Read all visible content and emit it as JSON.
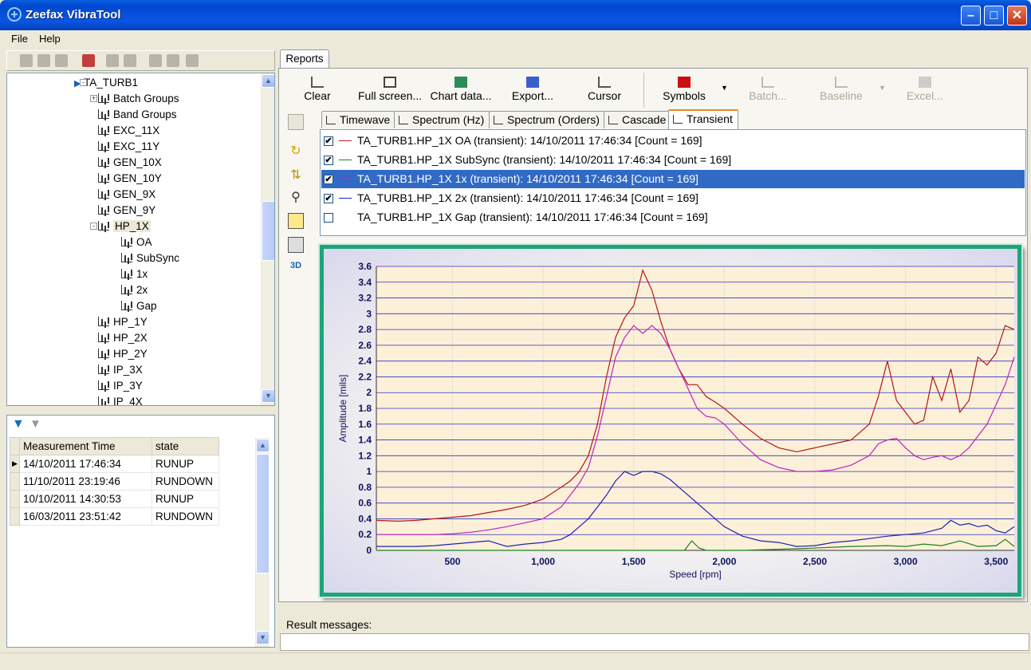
{
  "window": {
    "title": "Zeefax VibraTool"
  },
  "menu": {
    "file": "File",
    "help": "Help"
  },
  "tree": {
    "root": "TA_TURB1",
    "items": [
      "Batch Groups",
      "Band Groups",
      "EXC_11X",
      "EXC_11Y",
      "GEN_10X",
      "GEN_10Y",
      "GEN_9X",
      "GEN_9Y",
      "HP_1X",
      "OA",
      "SubSync",
      "1x",
      "2x",
      "Gap",
      "HP_1Y",
      "HP_2X",
      "HP_2Y",
      "IP_3X",
      "IP_3Y",
      "IP_4X"
    ]
  },
  "measurements": {
    "headers": [
      "Measurement Time",
      "state"
    ],
    "rows": [
      [
        "14/10/2011 17:46:34",
        "RUNUP"
      ],
      [
        "11/10/2011 23:19:46",
        "RUNDOWN"
      ],
      [
        "10/10/2011 14:30:53",
        "RUNUP"
      ],
      [
        "16/03/2011 23:51:42",
        "RUNDOWN"
      ]
    ]
  },
  "reports": {
    "tab": "Reports"
  },
  "toolbar": {
    "clear": "Clear",
    "fullscreen": "Full screen...",
    "chartdata": "Chart data...",
    "export": "Export...",
    "cursor": "Cursor",
    "symbols": "Symbols",
    "batch": "Batch...",
    "baseline": "Baseline",
    "excel": "Excel..."
  },
  "vtools": {
    "three_d": "3D"
  },
  "tabs": [
    "Timewave",
    "Spectrum (Hz)",
    "Spectrum (Orders)",
    "Cascade",
    "Transient"
  ],
  "series": [
    {
      "checked": true,
      "color": "#c02020",
      "text": "TA_TURB1.HP_1X OA (transient): 14/10/2011 17:46:34 [Count = 169]"
    },
    {
      "checked": true,
      "color": "#208020",
      "text": "TA_TURB1.HP_1X SubSync (transient): 14/10/2011 17:46:34 [Count = 169]"
    },
    {
      "checked": true,
      "color": "#d020d0",
      "text": "TA_TURB1.HP_1X 1x (transient): 14/10/2011 17:46:34 [Count = 169]"
    },
    {
      "checked": true,
      "color": "#2020c0",
      "text": "TA_TURB1.HP_1X 2x (transient): 14/10/2011 17:46:34 [Count = 169]"
    },
    {
      "checked": false,
      "color": "",
      "text": "TA_TURB1.HP_1X Gap (transient): 14/10/2011 17:46:34 [Count = 169]"
    }
  ],
  "result": {
    "label": "Result messages:"
  },
  "chart_data": {
    "type": "line",
    "xlabel": "Speed [rpm]",
    "ylabel": "Amplitude [mils]",
    "xlim": [
      80,
      3600
    ],
    "ylim": [
      0,
      3.6
    ],
    "xticks": [
      500,
      1000,
      1500,
      2000,
      2500,
      3000,
      3500
    ],
    "xticklabels": [
      "500",
      "1,000",
      "1,500",
      "2,000",
      "2,500",
      "3,000",
      "3,500"
    ],
    "yticks": [
      0,
      0.2,
      0.4,
      0.6,
      0.8,
      1,
      1.2,
      1.4,
      1.6,
      1.8,
      2,
      2.2,
      2.4,
      2.6,
      2.8,
      3,
      3.2,
      3.4,
      3.6
    ],
    "grid": true,
    "series": [
      {
        "color": "#b01818",
        "x": [
          80,
          200,
          300,
          400,
          500,
          600,
          700,
          800,
          900,
          1000,
          1100,
          1150,
          1200,
          1250,
          1300,
          1350,
          1400,
          1450,
          1500,
          1550,
          1600,
          1650,
          1700,
          1750,
          1800,
          1850,
          1900,
          1950,
          2000,
          2100,
          2200,
          2300,
          2400,
          2500,
          2600,
          2700,
          2800,
          2850,
          2900,
          2950,
          3000,
          3050,
          3100,
          3150,
          3200,
          3250,
          3300,
          3350,
          3400,
          3450,
          3500,
          3550,
          3600
        ],
        "y": [
          0.38,
          0.37,
          0.38,
          0.4,
          0.42,
          0.44,
          0.48,
          0.52,
          0.57,
          0.65,
          0.8,
          0.88,
          1.0,
          1.2,
          1.6,
          2.2,
          2.7,
          2.95,
          3.1,
          3.55,
          3.3,
          2.9,
          2.55,
          2.3,
          2.1,
          2.1,
          1.95,
          1.88,
          1.8,
          1.6,
          1.42,
          1.3,
          1.25,
          1.3,
          1.35,
          1.4,
          1.6,
          1.95,
          2.4,
          1.9,
          1.75,
          1.6,
          1.65,
          2.2,
          1.9,
          2.3,
          1.75,
          1.9,
          2.45,
          2.35,
          2.5,
          2.85,
          2.8
        ]
      },
      {
        "color": "#c020c0",
        "x": [
          80,
          200,
          300,
          400,
          500,
          600,
          700,
          800,
          900,
          1000,
          1100,
          1150,
          1200,
          1250,
          1300,
          1350,
          1400,
          1450,
          1500,
          1550,
          1600,
          1650,
          1700,
          1750,
          1800,
          1850,
          1900,
          1950,
          2000,
          2100,
          2200,
          2300,
          2400,
          2500,
          2600,
          2700,
          2800,
          2850,
          2900,
          2950,
          3000,
          3050,
          3100,
          3150,
          3200,
          3250,
          3300,
          3350,
          3400,
          3450,
          3500,
          3550,
          3600
        ],
        "y": [
          0.2,
          0.2,
          0.2,
          0.2,
          0.21,
          0.23,
          0.26,
          0.3,
          0.35,
          0.4,
          0.55,
          0.7,
          0.85,
          1.05,
          1.45,
          1.95,
          2.45,
          2.7,
          2.85,
          2.75,
          2.85,
          2.75,
          2.55,
          2.3,
          2.05,
          1.8,
          1.7,
          1.68,
          1.6,
          1.35,
          1.15,
          1.05,
          1.0,
          1.0,
          1.02,
          1.08,
          1.2,
          1.35,
          1.4,
          1.42,
          1.3,
          1.2,
          1.15,
          1.18,
          1.2,
          1.15,
          1.2,
          1.3,
          1.45,
          1.6,
          1.85,
          2.1,
          2.45
        ]
      },
      {
        "color": "#2020b0",
        "x": [
          80,
          200,
          300,
          400,
          500,
          600,
          700,
          800,
          900,
          1000,
          1100,
          1150,
          1200,
          1250,
          1300,
          1350,
          1400,
          1450,
          1500,
          1550,
          1600,
          1650,
          1700,
          1750,
          1800,
          1850,
          1900,
          1950,
          2000,
          2100,
          2200,
          2300,
          2400,
          2500,
          2600,
          2700,
          2800,
          2900,
          3000,
          3100,
          3200,
          3250,
          3300,
          3350,
          3400,
          3450,
          3500,
          3550,
          3600
        ],
        "y": [
          0.05,
          0.05,
          0.05,
          0.06,
          0.08,
          0.1,
          0.12,
          0.05,
          0.08,
          0.1,
          0.14,
          0.2,
          0.3,
          0.4,
          0.55,
          0.7,
          0.88,
          1.0,
          0.95,
          1.0,
          1.0,
          0.97,
          0.9,
          0.8,
          0.7,
          0.6,
          0.5,
          0.4,
          0.3,
          0.18,
          0.12,
          0.1,
          0.05,
          0.06,
          0.1,
          0.12,
          0.15,
          0.18,
          0.2,
          0.22,
          0.28,
          0.38,
          0.32,
          0.34,
          0.3,
          0.32,
          0.25,
          0.22,
          0.3
        ]
      },
      {
        "color": "#208020",
        "x": [
          80,
          300,
          600,
          900,
          1200,
          1500,
          1700,
          1780,
          1820,
          1860,
          1900,
          2100,
          2400,
          2700,
          2900,
          3000,
          3100,
          3200,
          3300,
          3400,
          3500,
          3550,
          3600
        ],
        "y": [
          0,
          0,
          0,
          0,
          0,
          0,
          0,
          0,
          0.12,
          0.03,
          0,
          0,
          0.02,
          0.05,
          0.06,
          0.05,
          0.08,
          0.06,
          0.12,
          0.05,
          0.06,
          0.14,
          0.05
        ]
      }
    ]
  }
}
